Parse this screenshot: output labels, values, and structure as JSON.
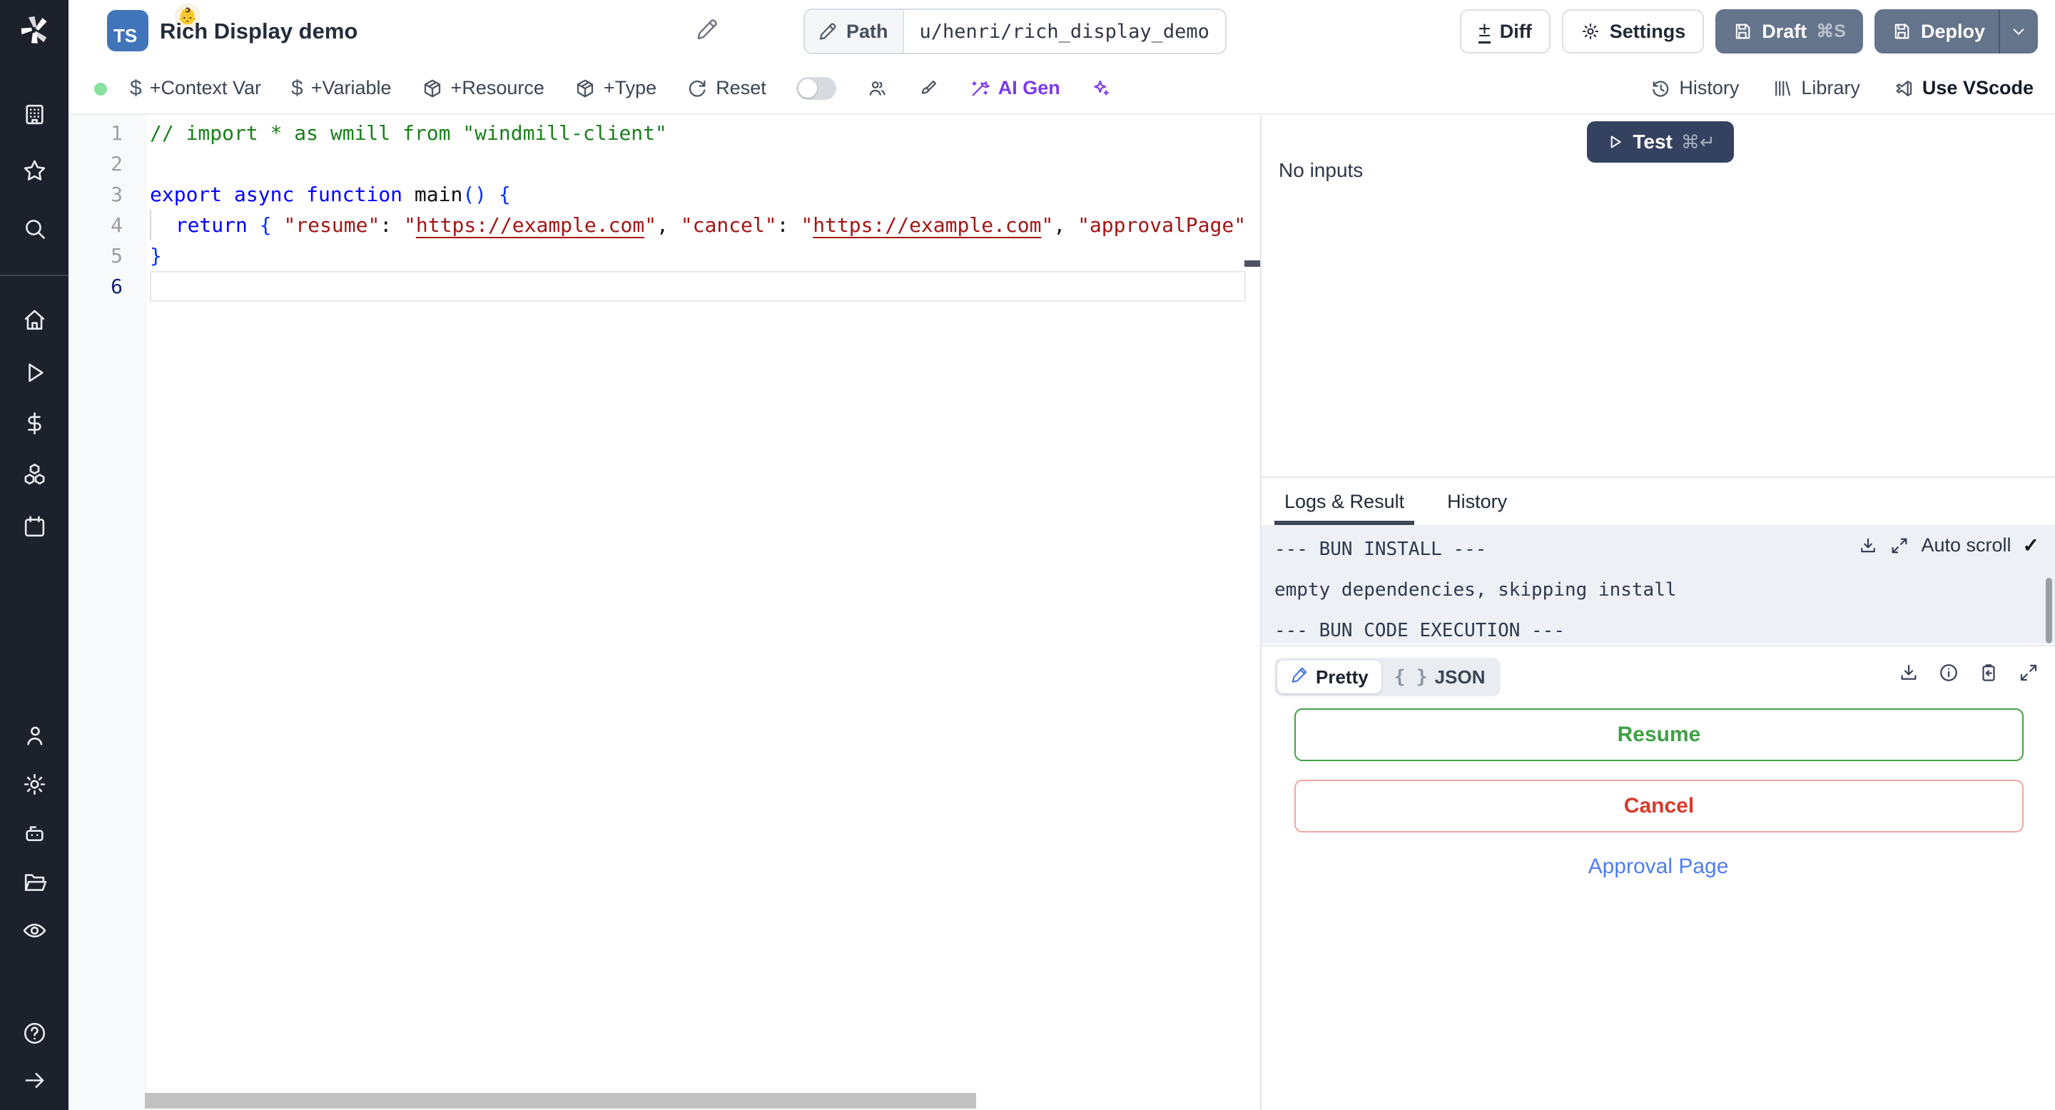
{
  "header": {
    "title": "Rich Display demo",
    "language_badge": "TS",
    "badge_emoji": "👶",
    "path_label": "Path",
    "path_value": "u/henri/rich_display_demo",
    "diff": "Diff",
    "settings": "Settings",
    "draft": "Draft",
    "draft_shortcut": "⌘S",
    "deploy": "Deploy"
  },
  "toolbar": {
    "items": [
      {
        "label": "+Context Var",
        "icon": "dollar-icon"
      },
      {
        "label": "+Variable",
        "icon": "dollar-icon"
      },
      {
        "label": "+Resource",
        "icon": "package-icon"
      },
      {
        "label": "+Type",
        "icon": "package-icon"
      }
    ],
    "reset": "Reset",
    "ai_gen": "AI Gen",
    "history": "History",
    "library": "Library",
    "vscode": "Use VScode"
  },
  "sidebar": {
    "icons": [
      "windmill-logo",
      "workspace-building-icon",
      "favorites-star-icon",
      "search-icon",
      "home-icon",
      "runs-play-icon",
      "variables-dollar-icon",
      "resources-cubes-icon",
      "schedules-calendar-icon",
      "users-person-icon",
      "settings-gear-icon",
      "workers-robot-icon",
      "folders-icon",
      "audit-eye-icon",
      "help-icon",
      "expand-arrow-icon"
    ]
  },
  "editor": {
    "lines": [
      {
        "tokens": [
          {
            "c": "cmt",
            "t": "// import * as wmill from \"windmill-client\""
          }
        ]
      },
      {
        "tokens": []
      },
      {
        "tokens": [
          {
            "c": "kw",
            "t": "export"
          },
          {
            "c": "def",
            "t": " "
          },
          {
            "c": "kw",
            "t": "async"
          },
          {
            "c": "def",
            "t": " "
          },
          {
            "c": "kw",
            "t": "function"
          },
          {
            "c": "def",
            "t": " main"
          },
          {
            "c": "br",
            "t": "()"
          },
          {
            "c": "def",
            "t": " "
          },
          {
            "c": "br",
            "t": "{"
          }
        ]
      },
      {
        "tokens": [
          {
            "c": "guide",
            "t": ""
          },
          {
            "c": "def",
            "t": "  "
          },
          {
            "c": "kw",
            "t": "return"
          },
          {
            "c": "def",
            "t": " "
          },
          {
            "c": "br",
            "t": "{"
          },
          {
            "c": "def",
            "t": " "
          },
          {
            "c": "str",
            "t": "\"resume\""
          },
          {
            "c": "def",
            "t": ": "
          },
          {
            "c": "str",
            "t": "\""
          },
          {
            "c": "url",
            "t": "https://example.com"
          },
          {
            "c": "str",
            "t": "\""
          },
          {
            "c": "def",
            "t": ", "
          },
          {
            "c": "str",
            "t": "\"cancel\""
          },
          {
            "c": "def",
            "t": ": "
          },
          {
            "c": "str",
            "t": "\""
          },
          {
            "c": "url",
            "t": "https://example.com"
          },
          {
            "c": "str",
            "t": "\""
          },
          {
            "c": "def",
            "t": ", "
          },
          {
            "c": "str",
            "t": "\"approvalPage\""
          },
          {
            "c": "def",
            "t": ": "
          }
        ]
      },
      {
        "tokens": [
          {
            "c": "br",
            "t": "}"
          }
        ]
      },
      {
        "tokens": [],
        "active": true
      }
    ]
  },
  "run_panel": {
    "test": "Test",
    "test_shortcut": "⌘↵",
    "no_inputs": "No inputs"
  },
  "tabs": {
    "logs": "Logs & Result",
    "history": "History"
  },
  "logs": {
    "lines": [
      "--- BUN INSTALL ---",
      "empty dependencies, skipping install",
      "--- BUN CODE EXECUTION ---"
    ],
    "auto_scroll": "Auto scroll",
    "check": "✓"
  },
  "result": {
    "pretty": "Pretty",
    "json_icon": "{ }",
    "json_label": "JSON",
    "resume": "Resume",
    "cancel": "Cancel",
    "link": "Approval Page"
  },
  "colors": {
    "sidebar_bg": "#1d212b",
    "draft_deploy_button": "#64748b",
    "test_button": "#35425f",
    "resume_green": "#3fa046",
    "cancel_red": "#da3b2b",
    "link_blue": "#4e7df5",
    "ai_purple": "#7c3aed",
    "ts_blue": "#4076b9",
    "status_dot_green": "#86e29e"
  }
}
